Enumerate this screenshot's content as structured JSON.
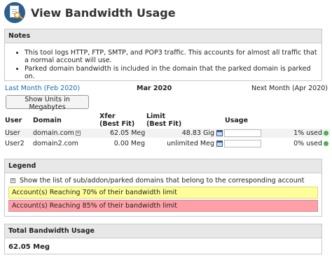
{
  "page": {
    "title": "View Bandwidth Usage"
  },
  "notes": {
    "heading": "Notes",
    "items": [
      "This tool logs HTTP, FTP, SMTP, and POP3 traffic. This accounts for almost all traffic that a normal account will use.",
      "Parked domain bandwidth is included in the domain that the parked domain is parked on."
    ]
  },
  "month_nav": {
    "previous": "Last Month (Feb 2020)",
    "current": "Mar 2020",
    "next": "Next Month (Apr 2020)"
  },
  "units_button": "Show Units in Megabytes",
  "table": {
    "headers": {
      "user": "User",
      "domain": "Domain",
      "xfer": "Xfer",
      "xfer_sub": "(Best Fit)",
      "limit": "Limit",
      "limit_sub": "(Best Fit)",
      "usage": "Usage"
    },
    "rows": [
      {
        "user": "User",
        "domain": "domain.com",
        "xfer": "62.05 Meg",
        "limit": "48.83 Gig",
        "usage": "1% used",
        "usage_fraction": 0.01
      },
      {
        "user": "User2",
        "domain": "domain2.com",
        "xfer": "0.00 Meg",
        "limit": "unlimited Meg",
        "usage": "0% used",
        "usage_fraction": 0.0
      }
    ]
  },
  "legend": {
    "heading": "Legend",
    "subdomains_text": "Show the list of sub/addon/parked domains that belong to the corresponding account",
    "warn70": "Account(s) Reaching 70% of their bandwidth limit",
    "warn85": "Account(s) Reaching 85% of their bandwidth limit"
  },
  "total": {
    "heading": "Total Bandwidth Usage",
    "value": "62.05 Meg"
  },
  "colors": {
    "link": "#1a6bb4",
    "warn70": "#ffff99",
    "warn85": "#ffa0a8",
    "status_ok": "#4caf50"
  },
  "icons": [
    "bandwidth-app-icon",
    "expand-plus-icon",
    "calendar-icon",
    "status-ok-icon"
  ]
}
